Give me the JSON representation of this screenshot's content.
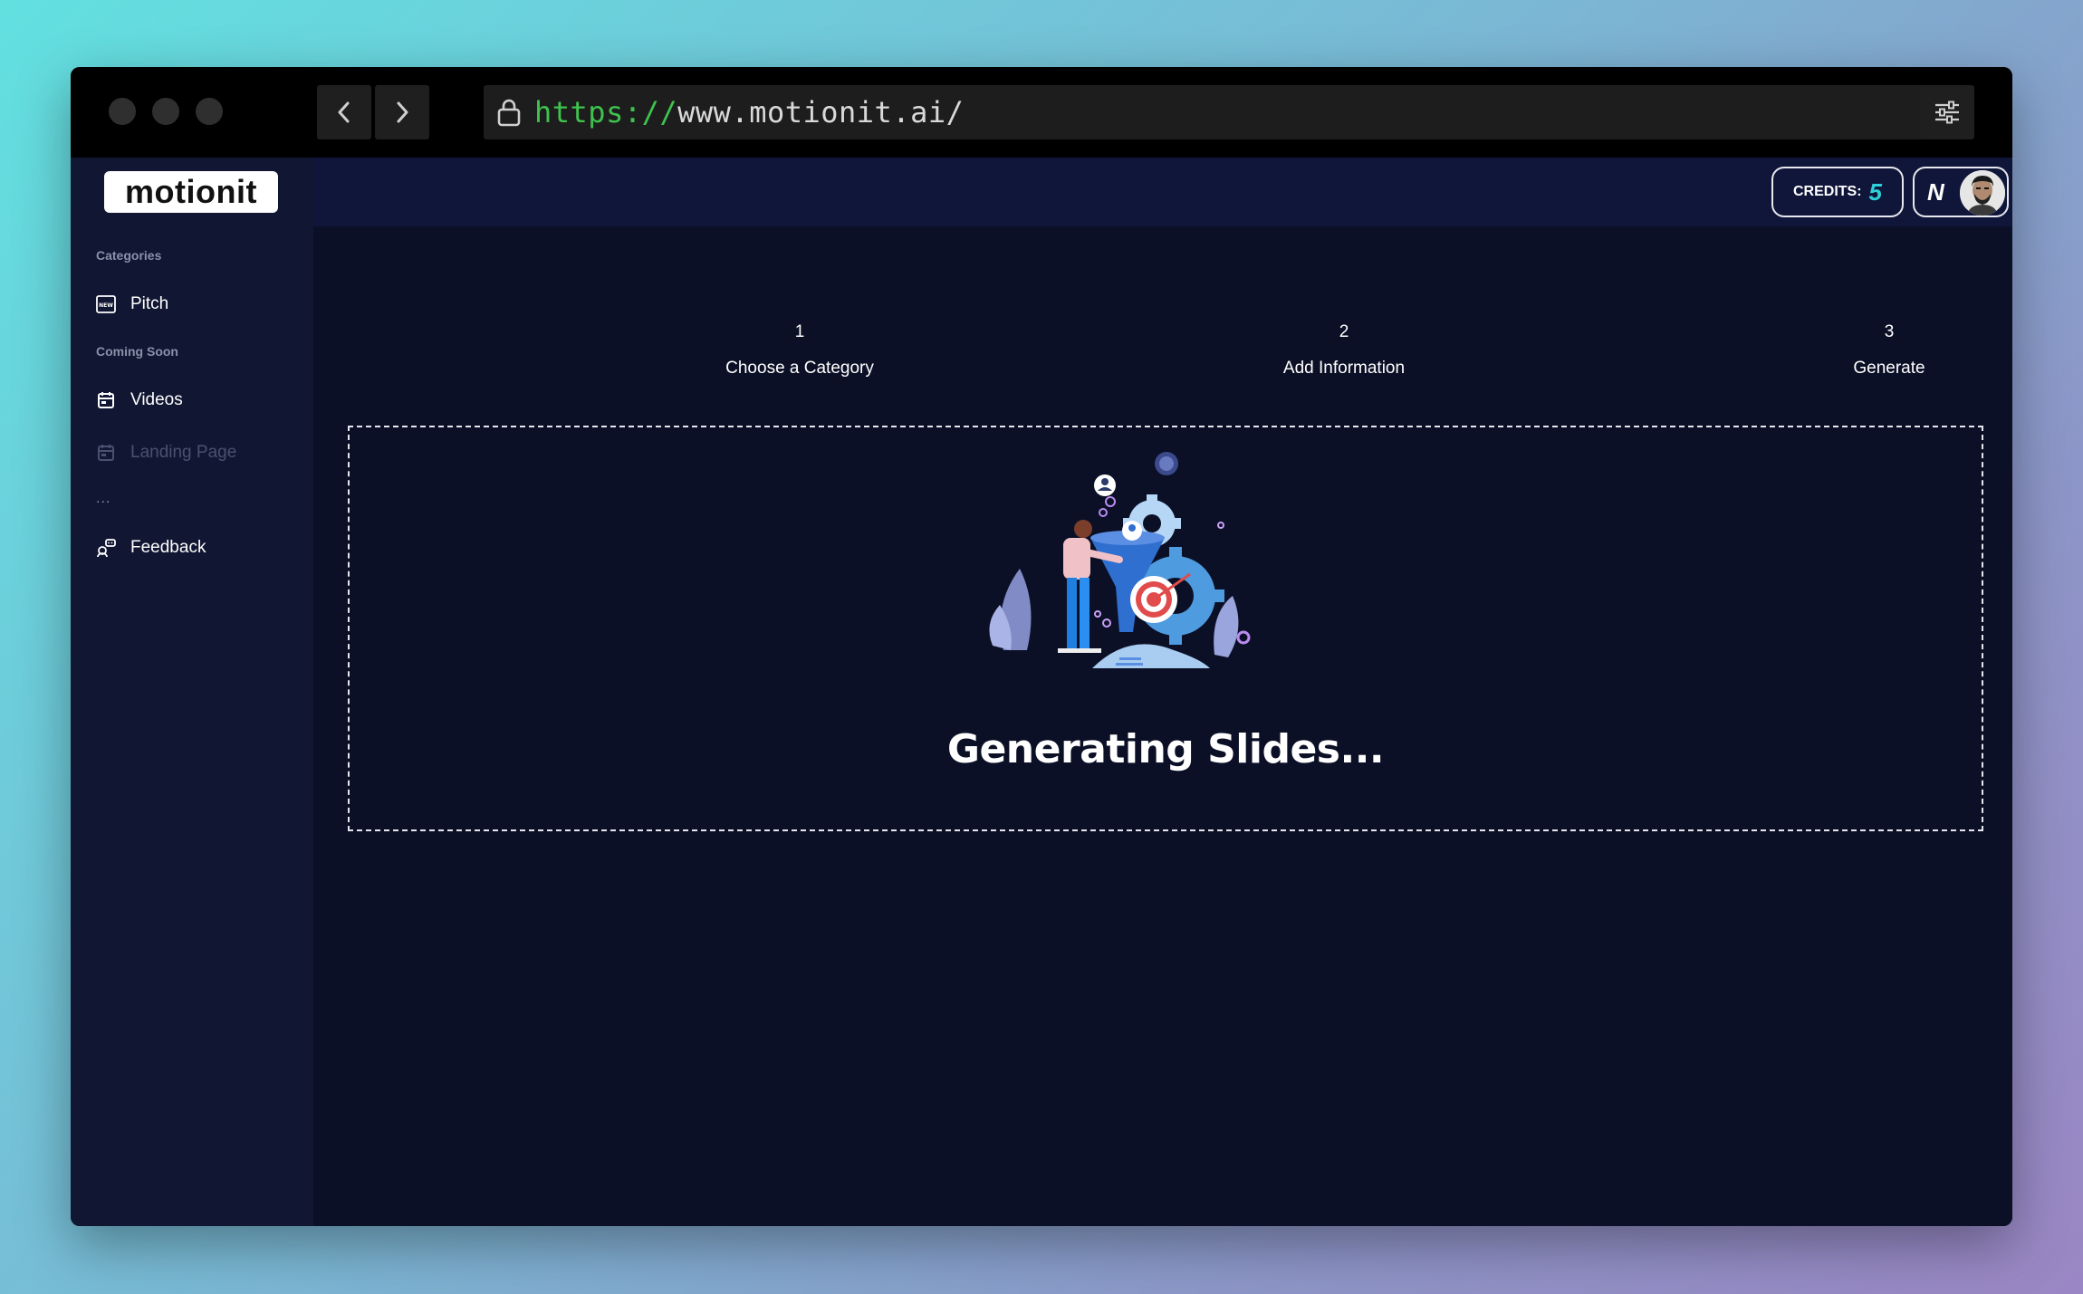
{
  "browser": {
    "url_protocol": "https://",
    "url_host": "www.motionit.ai/"
  },
  "app": {
    "logo": "motionit"
  },
  "sidebar": {
    "section_categories": "Categories",
    "item_pitch": "Pitch",
    "section_coming_soon": "Coming Soon",
    "item_videos": "Videos",
    "item_landing_page": "Landing Page",
    "more": "...",
    "item_feedback": "Feedback"
  },
  "header": {
    "credits_label": "CREDITS:",
    "credits_value": "5",
    "user_initial": "N"
  },
  "steps": [
    {
      "number": "1",
      "label": "Choose a Category"
    },
    {
      "number": "2",
      "label": "Add Information"
    },
    {
      "number": "3",
      "label": "Generate"
    }
  ],
  "status": {
    "title": "Generating Slides..."
  },
  "colors": {
    "accent": "#2ed0d8",
    "url_protocol": "#3fc24f",
    "sidebar_bg": "#111733",
    "main_bg": "#0b1026"
  }
}
